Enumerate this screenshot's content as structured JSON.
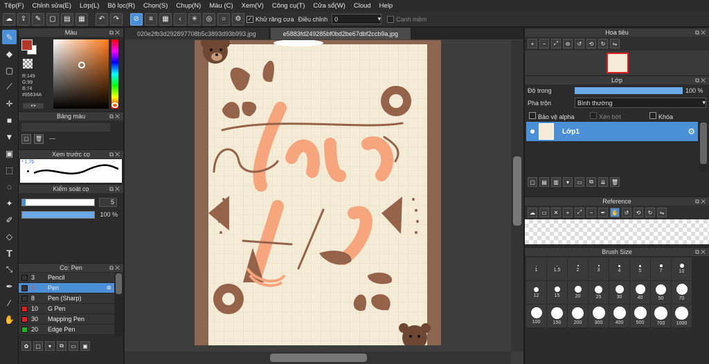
{
  "menu": [
    "Tệp(F)",
    "Chỉnh sửa(E)",
    "Lớp(L)",
    "Bộ lọc(R)",
    "Chọn(S)",
    "Chụp(N)",
    "Màu (C)",
    "Xem(V)",
    "Công cụ(T)",
    "Cửa sổ(W)",
    "Cloud",
    "Help"
  ],
  "toolbar": {
    "antialias_label": "Khử răng cưa",
    "correction_label": "Điều chỉnh",
    "correction_value": "0",
    "edge_label": "Cạnh mềm"
  },
  "tabs": [
    "020e2fb3d292897708b5c3893d93b993.jpg",
    "e5883fd249285bf0bd2be67dbf2ccb9a.jpg"
  ],
  "color_panel": {
    "title": "Màu",
    "r": "R:149",
    "g": "G:99",
    "b": "B:74",
    "hex": "#95634A",
    "current_color": "#95634A"
  },
  "palette_panel": {
    "title": "Bảng màu",
    "value": "---"
  },
  "brush_preview": {
    "title": "Xem trước cọ",
    "size": "1.76"
  },
  "brush_control": {
    "title": "Kiểm soát cọ",
    "size_value": "5",
    "opacity_value": "100 %",
    "size_fraction": 0.0,
    "opacity_fraction": 1.0
  },
  "pen_panel": {
    "title": "Cọ: Pen",
    "items": [
      {
        "num": "3",
        "name": "Pencil",
        "color": "#333333",
        "selected": false
      },
      {
        "num": "5",
        "name": "Pen",
        "color": "#333333",
        "selected": true
      },
      {
        "num": "8",
        "name": "Pen (Sharp)",
        "color": "#333333",
        "selected": false
      },
      {
        "num": "10",
        "name": "G Pen",
        "color": "#e02020",
        "selected": false
      },
      {
        "num": "30",
        "name": "Mapping Pen",
        "color": "#e02020",
        "selected": false
      },
      {
        "num": "20",
        "name": "Edge Pen",
        "color": "#20b020",
        "selected": false
      }
    ]
  },
  "navigator": {
    "title": "Hoa tiêu"
  },
  "layer_panel": {
    "title": "Lớp",
    "opacity_label": "Độ trong",
    "opacity_value": "100 %",
    "opacity_fraction": 1.0,
    "blend_label": "Pha trộn",
    "blend_value": "Bình thường",
    "protect_alpha": "Bảo vệ alpha",
    "clipping": "Xén bớt",
    "lock": "Khóa",
    "layer_name": "Lớp1"
  },
  "reference": {
    "title": "Reference"
  },
  "brush_size": {
    "title": "Brush Size",
    "rows": [
      [
        "1",
        "1.5",
        "2",
        "3",
        "4",
        "5",
        "7",
        "10"
      ],
      [
        "12",
        "15",
        "20",
        "25",
        "30",
        "40",
        "50",
        "70"
      ],
      [
        "100",
        "150",
        "200",
        "300",
        "400",
        "500",
        "700",
        "1000"
      ]
    ]
  },
  "colors": {
    "accent": "#4b8fd6",
    "brown": "#95634A",
    "peach": "#f6a57d",
    "paper": "#f4ecd6"
  }
}
